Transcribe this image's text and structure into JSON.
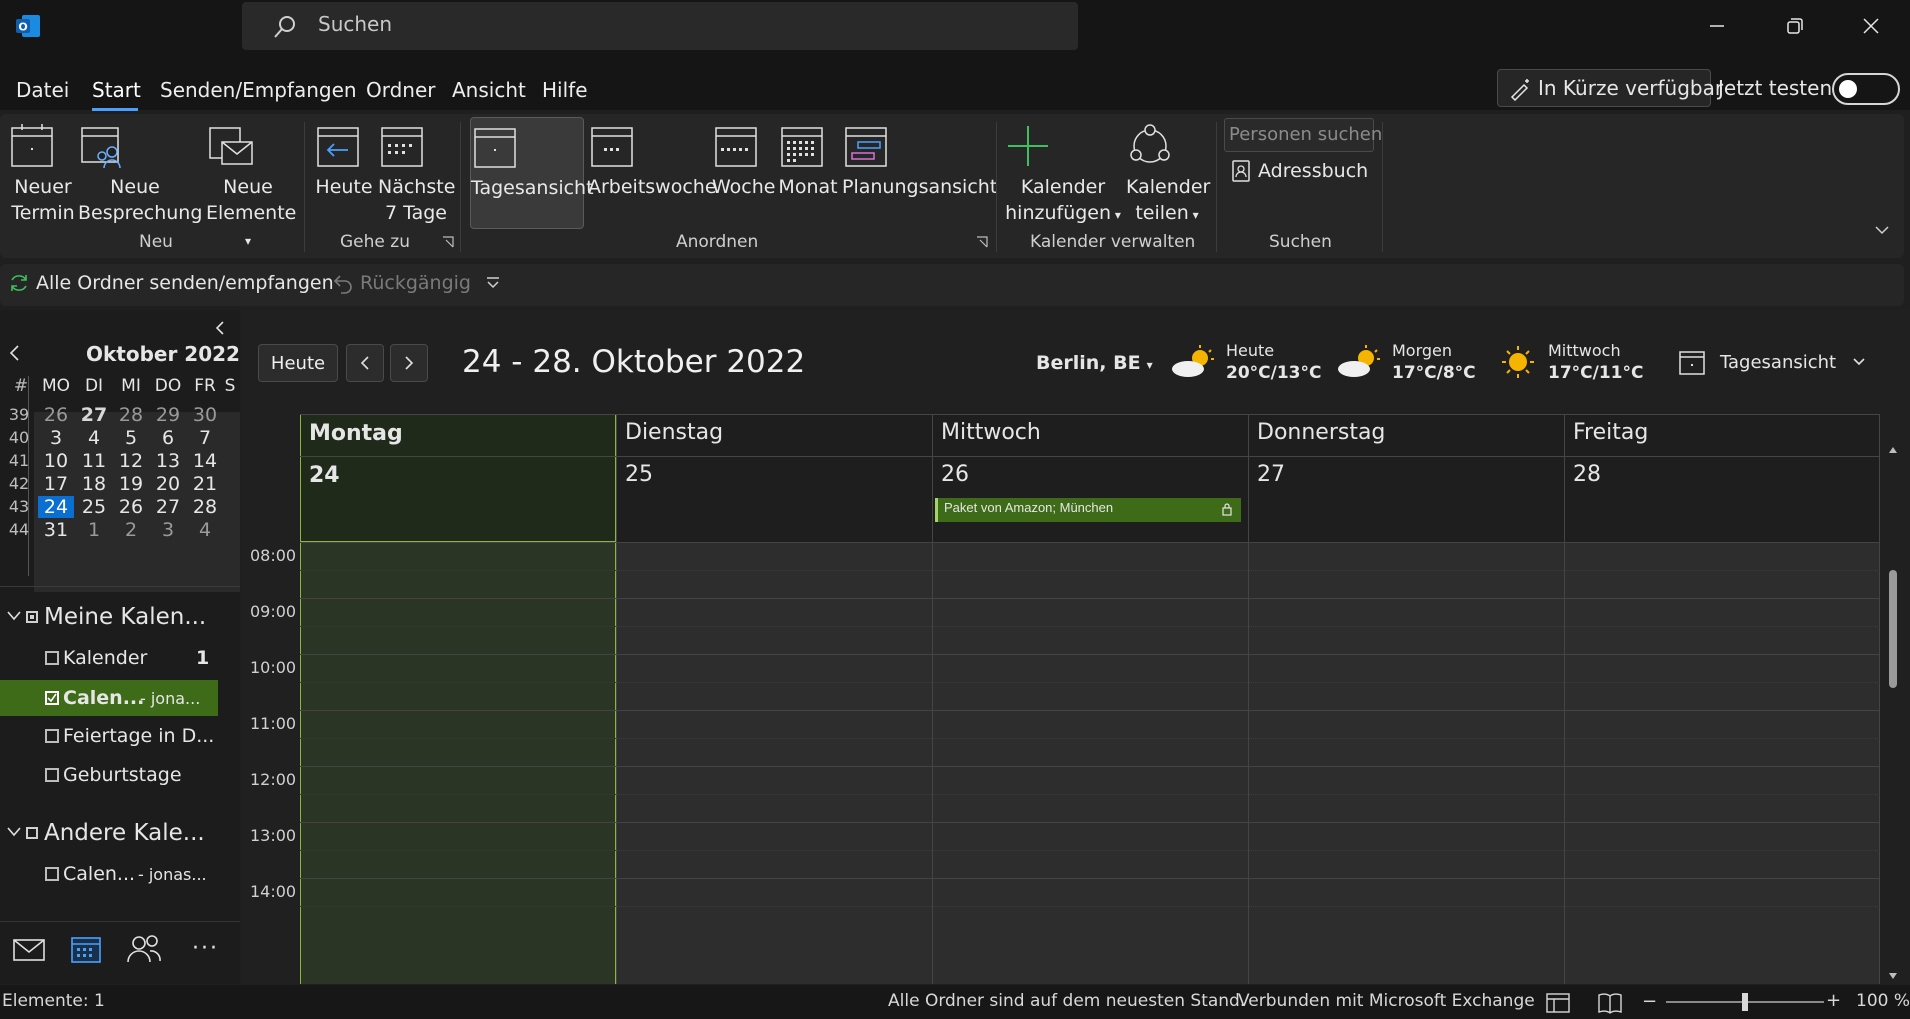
{
  "titlebar": {
    "search_placeholder": "Suchen"
  },
  "menu": {
    "items": [
      "Datei",
      "Start",
      "Senden/Empfangen",
      "Ordner",
      "Ansicht",
      "Hilfe"
    ],
    "in_kurze": "In Kürze verfügbar",
    "jetzt_testen": "Jetzt testen",
    "toggle_on": false
  },
  "ribbon": {
    "neu": {
      "neuer_termin": [
        "Neuer",
        "Termin"
      ],
      "neue_besprechung": [
        "Neue",
        "Besprechung"
      ],
      "neue_elemente": [
        "Neue",
        "Elemente"
      ],
      "label": "Neu"
    },
    "gehe_zu": {
      "heute": "Heute",
      "naechste": [
        "Nächste",
        "7 Tage"
      ],
      "label": "Gehe zu"
    },
    "anordnen": {
      "tagesansicht": "Tagesansicht",
      "arbeitswoche": "Arbeitswoche",
      "woche": "Woche",
      "monat": "Monat",
      "planungsansicht": "Planungsansicht",
      "label": "Anordnen"
    },
    "verwalten": {
      "hinzufuegen": [
        "Kalender",
        "hinzufügen"
      ],
      "teilen": [
        "Kalender",
        "teilen"
      ],
      "label": "Kalender verwalten"
    },
    "suchen": {
      "personen_suchen": "Personen suchen",
      "adressbuch": "Adressbuch",
      "label": "Suchen"
    }
  },
  "qat": {
    "send_receive_all": "Alle Ordner senden/empfangen",
    "undo": "Rückgängig"
  },
  "mini_calendar": {
    "month_title": "Oktober 2022",
    "weekday_headers": [
      "#",
      "MO",
      "DI",
      "MI",
      "DO",
      "FR",
      "S"
    ],
    "rows": [
      {
        "week": "39",
        "days": [
          "26",
          "27",
          "28",
          "29",
          "30"
        ]
      },
      {
        "week": "40",
        "days": [
          "3",
          "4",
          "5",
          "6",
          "7"
        ]
      },
      {
        "week": "41",
        "days": [
          "10",
          "11",
          "12",
          "13",
          "14"
        ]
      },
      {
        "week": "42",
        "days": [
          "17",
          "18",
          "19",
          "20",
          "21"
        ]
      },
      {
        "week": "43",
        "days": [
          "24",
          "25",
          "26",
          "27",
          "28"
        ]
      },
      {
        "week": "44",
        "days": [
          "31",
          "1",
          "2",
          "3",
          "4"
        ]
      }
    ]
  },
  "folders": {
    "group_mine": "Meine Kalen...",
    "kalender": "Kalender",
    "kalender_count": "1",
    "calen_selected": "Calen...",
    "calen_selected_owner": "- jona...",
    "feiertage": "Feiertage in D...",
    "geburtstage": "Geburtstage",
    "group_other": "Andere Kale...",
    "calen_other": "Calen...",
    "calen_other_owner": "- jonas..."
  },
  "calendar": {
    "today_button": "Heute",
    "range_title": "24 - 28. Oktober 2022",
    "location": "Berlin, BE",
    "weather": [
      {
        "day": "Heute",
        "temp": "20°C/13°C",
        "icon": "partly-sunny-icon"
      },
      {
        "day": "Morgen",
        "temp": "17°C/8°C",
        "icon": "partly-sunny-icon"
      },
      {
        "day": "Mittwoch",
        "temp": "17°C/11°C",
        "icon": "sunny-icon"
      }
    ],
    "view_selector": "Tagesansicht",
    "days": [
      {
        "name": "Montag",
        "num": "24"
      },
      {
        "name": "Dienstag",
        "num": "25"
      },
      {
        "name": "Mittwoch",
        "num": "26"
      },
      {
        "name": "Donnerstag",
        "num": "27"
      },
      {
        "name": "Freitag",
        "num": "28"
      }
    ],
    "event": {
      "title": "Paket von Amazon; München"
    },
    "times": [
      "08:00",
      "09:00",
      "10:00",
      "11:00",
      "12:00",
      "13:00",
      "14:00"
    ],
    "colors": {
      "today_col": "#2b3526",
      "today_head": "#1f2a1b",
      "today_border": "#8db542",
      "event": "#3d6b17",
      "accent": "#0a6fd1"
    }
  },
  "status": {
    "elements": "Elemente: 1",
    "up_to_date": "Alle Ordner sind auf dem neuesten Stand.",
    "connected": "Verbunden mit Microsoft Exchange",
    "zoom": "100 %"
  }
}
